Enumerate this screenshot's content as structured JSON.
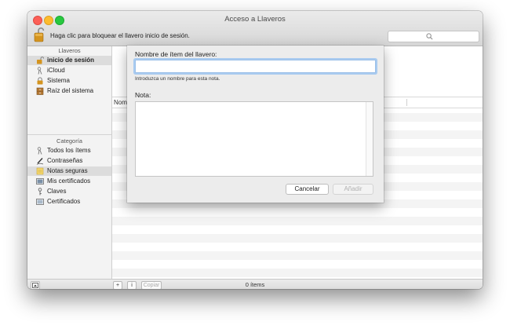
{
  "window": {
    "title": "Acceso a Llaveros"
  },
  "toolbar": {
    "lock_text": "Haga clic para bloquear el llavero inicio de sesión.",
    "search_value": ""
  },
  "sidebar": {
    "keychains_header": "Llaveros",
    "keychains": [
      {
        "label": "inicio de sesión",
        "icon": "lock-open-icon",
        "selected": true
      },
      {
        "label": "iCloud",
        "icon": "keychain-icon",
        "selected": false
      },
      {
        "label": "Sistema",
        "icon": "lock-icon",
        "selected": false
      },
      {
        "label": "Raíz del sistema",
        "icon": "cabinet-icon",
        "selected": false
      }
    ],
    "category_header": "Categoría",
    "categories": [
      {
        "label": "Todos los ítems",
        "icon": "keychain-icon",
        "selected": false
      },
      {
        "label": "Contraseñas",
        "icon": "pen-icon",
        "selected": false
      },
      {
        "label": "Notas seguras",
        "icon": "note-icon",
        "selected": true
      },
      {
        "label": "Mis certificados",
        "icon": "certificate-icon",
        "selected": false
      },
      {
        "label": "Claves",
        "icon": "key-icon",
        "selected": false
      },
      {
        "label": "Certificados",
        "icon": "certificate-icon",
        "selected": false
      }
    ]
  },
  "table": {
    "column_name": "Nomb"
  },
  "bottom": {
    "copy_label": "Copiar",
    "item_count": "0 ítems"
  },
  "dialog": {
    "name_label": "Nombre de ítem del llavero:",
    "name_value": "",
    "hint": "Introduzca un nombre para esta nota.",
    "note_label": "Nota:",
    "note_value": "",
    "cancel_label": "Cancelar",
    "add_label": "Añadir"
  }
}
